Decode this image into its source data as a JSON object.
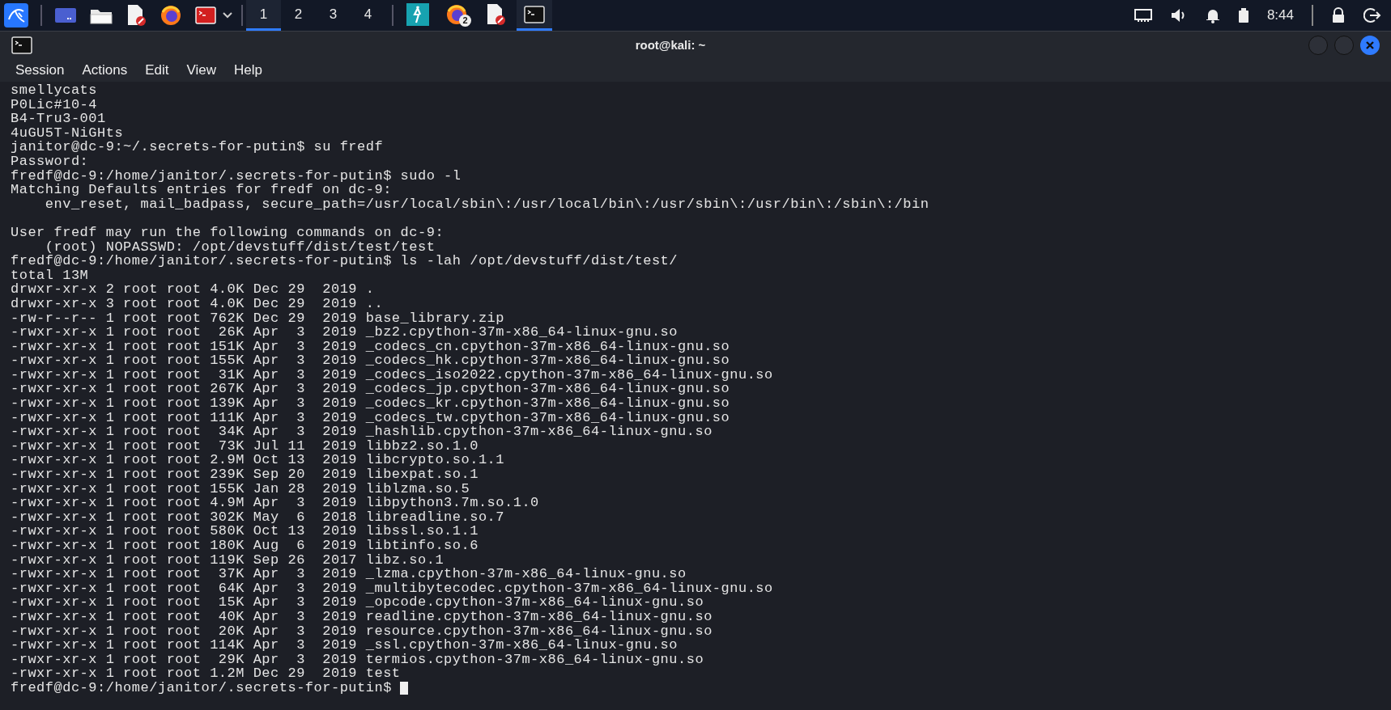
{
  "taskbar": {
    "launchers": [
      {
        "kind": "kali"
      },
      {
        "kind": "desktop"
      },
      {
        "kind": "folder"
      },
      {
        "kind": "editor"
      },
      {
        "kind": "firefox"
      },
      {
        "kind": "terminal-red"
      }
    ],
    "workspaces": [
      {
        "label": "1",
        "selected": true
      },
      {
        "label": "2",
        "selected": false
      },
      {
        "label": "3",
        "selected": false
      },
      {
        "label": "4",
        "selected": false
      }
    ],
    "tasks": [
      {
        "kind": "burp",
        "selected": false
      },
      {
        "kind": "firefox",
        "selected": false,
        "badge": "2"
      },
      {
        "kind": "editor",
        "selected": false
      },
      {
        "kind": "terminal",
        "selected": true
      }
    ],
    "clock": "8:44"
  },
  "window": {
    "title": "root@kali: ~",
    "menu": [
      "Session",
      "Actions",
      "Edit",
      "View",
      "Help"
    ],
    "blocks": [
      {
        "lines": [
          {
            "text": "smellycats"
          },
          {
            "text": "P0Lic#10-4"
          },
          {
            "text": "B4-Tru3-001"
          },
          {
            "text": "4uGU5T-NiGHts"
          },
          {
            "text": "janitor@dc-9:~/.secrets-for-putin$ su fredf"
          },
          {
            "text": "Password:"
          },
          {
            "text": "fredf@dc-9:/home/janitor/.secrets-for-putin$ sudo -l"
          },
          {
            "text": "Matching Defaults entries for fredf on dc-9:"
          },
          {
            "text": "    env_reset, mail_badpass, secure_path=/usr/local/sbin\\:/usr/local/bin\\:/usr/sbin\\:/usr/bin\\:/sbin\\:/bin"
          }
        ]
      },
      {
        "lines": [
          {
            "text": "User fredf may run the following commands on dc-9:"
          },
          {
            "text": "    (root) NOPASSWD: /opt/devstuff/dist/test/test"
          },
          {
            "text": "fredf@dc-9:/home/janitor/.secrets-for-putin$ ls -lah /opt/devstuff/dist/test/"
          },
          {
            "text": "total 13M"
          },
          {
            "text": "drwxr-xr-x 2 root root 4.0K Dec 29  2019 ."
          },
          {
            "text": "drwxr-xr-x 3 root root 4.0K Dec 29  2019 .."
          },
          {
            "text": "-rw-r--r-- 1 root root 762K Dec 29  2019 base_library.zip"
          },
          {
            "text": "-rwxr-xr-x 1 root root  26K Apr  3  2019 _bz2.cpython-37m-x86_64-linux-gnu.so"
          },
          {
            "text": "-rwxr-xr-x 1 root root 151K Apr  3  2019 _codecs_cn.cpython-37m-x86_64-linux-gnu.so"
          },
          {
            "text": "-rwxr-xr-x 1 root root 155K Apr  3  2019 _codecs_hk.cpython-37m-x86_64-linux-gnu.so"
          },
          {
            "text": "-rwxr-xr-x 1 root root  31K Apr  3  2019 _codecs_iso2022.cpython-37m-x86_64-linux-gnu.so"
          },
          {
            "text": "-rwxr-xr-x 1 root root 267K Apr  3  2019 _codecs_jp.cpython-37m-x86_64-linux-gnu.so"
          },
          {
            "text": "-rwxr-xr-x 1 root root 139K Apr  3  2019 _codecs_kr.cpython-37m-x86_64-linux-gnu.so"
          },
          {
            "text": "-rwxr-xr-x 1 root root 111K Apr  3  2019 _codecs_tw.cpython-37m-x86_64-linux-gnu.so"
          },
          {
            "text": "-rwxr-xr-x 1 root root  34K Apr  3  2019 _hashlib.cpython-37m-x86_64-linux-gnu.so"
          },
          {
            "text": "-rwxr-xr-x 1 root root  73K Jul 11  2019 libbz2.so.1.0"
          },
          {
            "text": "-rwxr-xr-x 1 root root 2.9M Oct 13  2019 libcrypto.so.1.1"
          },
          {
            "text": "-rwxr-xr-x 1 root root 239K Sep 20  2019 libexpat.so.1"
          },
          {
            "text": "-rwxr-xr-x 1 root root 155K Jan 28  2019 liblzma.so.5"
          },
          {
            "text": "-rwxr-xr-x 1 root root 4.9M Apr  3  2019 libpython3.7m.so.1.0"
          },
          {
            "text": "-rwxr-xr-x 1 root root 302K May  6  2018 libreadline.so.7"
          },
          {
            "text": "-rwxr-xr-x 1 root root 580K Oct 13  2019 libssl.so.1.1"
          },
          {
            "text": "-rwxr-xr-x 1 root root 180K Aug  6  2019 libtinfo.so.6"
          },
          {
            "text": "-rwxr-xr-x 1 root root 119K Sep 26  2017 libz.so.1"
          },
          {
            "text": "-rwxr-xr-x 1 root root  37K Apr  3  2019 _lzma.cpython-37m-x86_64-linux-gnu.so"
          },
          {
            "text": "-rwxr-xr-x 1 root root  64K Apr  3  2019 _multibytecodec.cpython-37m-x86_64-linux-gnu.so"
          },
          {
            "text": "-rwxr-xr-x 1 root root  15K Apr  3  2019 _opcode.cpython-37m-x86_64-linux-gnu.so"
          },
          {
            "text": "-rwxr-xr-x 1 root root  40K Apr  3  2019 readline.cpython-37m-x86_64-linux-gnu.so"
          },
          {
            "text": "-rwxr-xr-x 1 root root  20K Apr  3  2019 resource.cpython-37m-x86_64-linux-gnu.so"
          },
          {
            "text": "-rwxr-xr-x 1 root root 114K Apr  3  2019 _ssl.cpython-37m-x86_64-linux-gnu.so"
          },
          {
            "text": "-rwxr-xr-x 1 root root  29K Apr  3  2019 termios.cpython-37m-x86_64-linux-gnu.so"
          },
          {
            "text": "-rwxr-xr-x 1 root root 1.2M Dec 29  2019 test"
          }
        ]
      }
    ],
    "prompt": "fredf@dc-9:/home/janitor/.secrets-for-putin$",
    "cursor": true
  }
}
